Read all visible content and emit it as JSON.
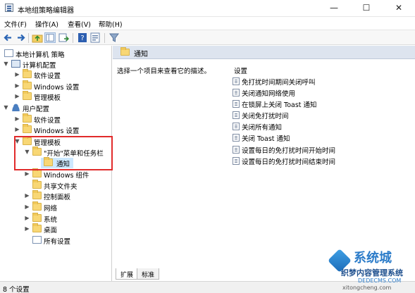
{
  "window": {
    "title": "本地组策略编辑器",
    "minimize_glyph": "—",
    "maximize_glyph": "☐",
    "close_glyph": "✕"
  },
  "menu": {
    "items": [
      "文件(F)",
      "操作(A)",
      "查看(V)",
      "帮助(H)"
    ]
  },
  "toolbar": {
    "icons": [
      "back-icon",
      "forward-icon",
      "up-folder-icon",
      "show-hide-tree-icon",
      "export-list-icon",
      "help-icon",
      "properties-icon",
      "filter-icon"
    ]
  },
  "tree": {
    "items": [
      {
        "label": "本地计算机 策略",
        "level": 0,
        "expanded": true,
        "icon": "policy-icon"
      },
      {
        "label": "计算机配置",
        "level": 1,
        "expanded": true,
        "icon": "computer-icon"
      },
      {
        "label": "软件设置",
        "level": 2,
        "expanded": false,
        "icon": "folder-icon"
      },
      {
        "label": "Windows 设置",
        "level": 2,
        "expanded": false,
        "icon": "folder-icon"
      },
      {
        "label": "管理模板",
        "level": 2,
        "expanded": false,
        "icon": "folder-icon"
      },
      {
        "label": "用户配置",
        "level": 1,
        "expanded": true,
        "icon": "user-icon"
      },
      {
        "label": "软件设置",
        "level": 2,
        "expanded": false,
        "icon": "folder-icon"
      },
      {
        "label": "Windows 设置",
        "level": 2,
        "expanded": false,
        "icon": "folder-icon"
      },
      {
        "label": "管理模板",
        "level": 2,
        "expanded": true,
        "icon": "folder-icon"
      },
      {
        "label": "\"开始\"菜单和任务栏",
        "level": 3,
        "expanded": true,
        "icon": "folder-icon"
      },
      {
        "label": "通知",
        "level": 4,
        "expanded": false,
        "icon": "folder-icon",
        "selected": true
      },
      {
        "label": "Windows 组件",
        "level": 3,
        "expanded": false,
        "icon": "folder-icon"
      },
      {
        "label": "共享文件夹",
        "level": 3,
        "expanded": false,
        "icon": "folder-icon"
      },
      {
        "label": "控制面板",
        "level": 3,
        "expanded": false,
        "icon": "folder-icon"
      },
      {
        "label": "网络",
        "level": 3,
        "expanded": false,
        "icon": "folder-icon"
      },
      {
        "label": "系统",
        "level": 3,
        "expanded": false,
        "icon": "folder-icon"
      },
      {
        "label": "桌面",
        "level": 3,
        "expanded": false,
        "icon": "folder-icon"
      },
      {
        "label": "所有设置",
        "level": 3,
        "expanded": false,
        "icon": "settings-icon"
      }
    ]
  },
  "right_pane": {
    "header": "通知",
    "description": "选择一个项目来查看它的描述。",
    "settings_header": "设置",
    "settings": [
      "免打扰时间期间关闭呼叫",
      "关闭通知网络使用",
      "在锁屏上关闭 Toast 通知",
      "关闭免打扰时间",
      "关闭所有通知",
      "关闭 Toast 通知",
      "设置每日的免打扰时间开始时间",
      "设置每日的免打扰时间结束时间"
    ]
  },
  "tabs": [
    "扩展",
    "标准"
  ],
  "status": {
    "text": "8 个设置"
  },
  "watermark": {
    "brand": "系统城",
    "cn": "织梦内容管理系统",
    "url": "DEDECMS.COM",
    "url2": "xitongcheng.com"
  },
  "colors": {
    "highlight_box": "#e12b2b",
    "selected_row": "#cce8ff",
    "header_bg": "#dde4ef"
  }
}
